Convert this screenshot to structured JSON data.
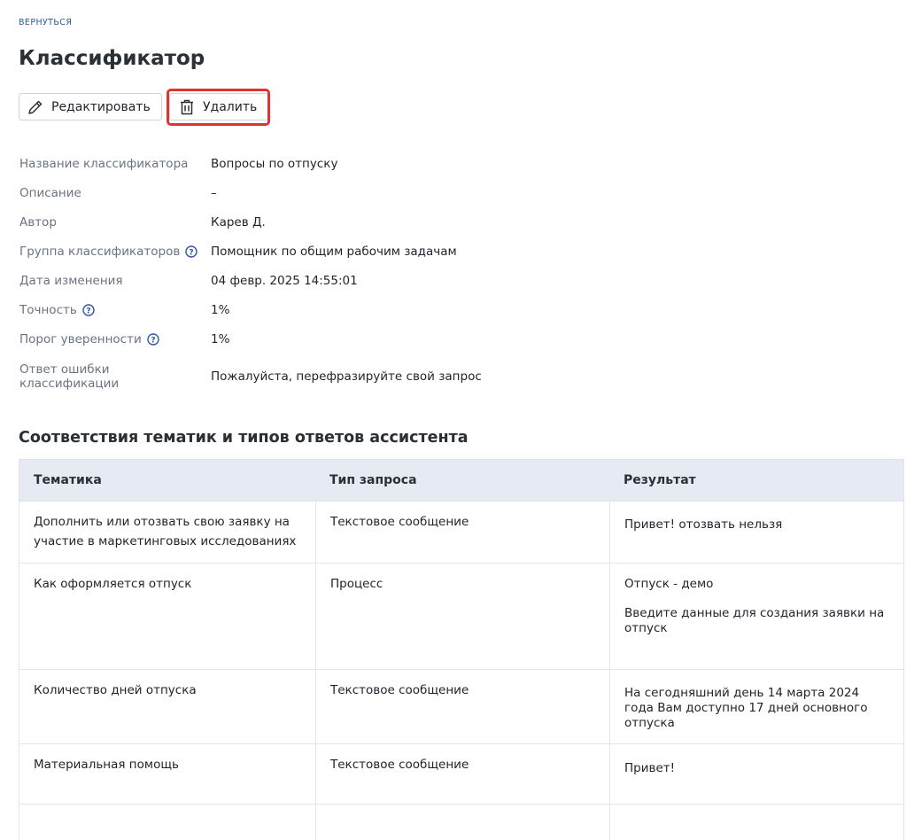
{
  "nav": {
    "back_label": "ВЕРНУТЬСЯ"
  },
  "page": {
    "title": "Классификатор"
  },
  "toolbar": {
    "edit_label": "Редактировать",
    "delete_label": "Удалить"
  },
  "properties": [
    {
      "label": "Название классификатора",
      "value": "Вопросы по отпуску",
      "help": false
    },
    {
      "label": "Описание",
      "value": "–",
      "help": false
    },
    {
      "label": "Автор",
      "value": "Карев Д.",
      "help": false
    },
    {
      "label": "Группа классификаторов",
      "value": "Помощник по общим рабочим задачам",
      "help": true
    },
    {
      "label": "Дата изменения",
      "value": "04 февр. 2025 14:55:01",
      "help": false
    },
    {
      "label": "Точность",
      "value": "1%",
      "help": true
    },
    {
      "label": "Порог уверенности",
      "value": "1%",
      "help": true
    },
    {
      "label": "Ответ ошибки классификации",
      "value": "Пожалуйста, перефразируйте свой запрос",
      "help": false
    }
  ],
  "section": {
    "title": "Соответствия тематик и типов ответов ассистента"
  },
  "table": {
    "columns": [
      "Тематика",
      "Тип запроса",
      "Результат"
    ],
    "rows": [
      {
        "topic": "Дополнить или отозвать свою заявку на участие в маркетинговых исследованиях",
        "type": "Текстовое сообщение",
        "result": [
          "Привет! отозвать нельзя"
        ]
      },
      {
        "topic": "Как оформляется отпуск",
        "type": "Процесс",
        "result": [
          "Отпуск - демо",
          "Введите данные для создания заявки на отпуск"
        ]
      },
      {
        "topic": "Количество дней отпуска",
        "type": "Текстовое сообщение",
        "result": [
          "На сегодняшний день 14 марта 2024 года Вам доступно 17 дней основного отпуска"
        ]
      },
      {
        "topic": "Материальная помощь",
        "type": "Текстовое сообщение",
        "result": [
          "Привет!"
        ]
      },
      {
        "topic": "",
        "type": "",
        "result": [
          ""
        ]
      }
    ]
  },
  "colors": {
    "accent": "#2c5aa0",
    "highlight": "#e0342c",
    "header_bg": "#e6ebf3"
  }
}
